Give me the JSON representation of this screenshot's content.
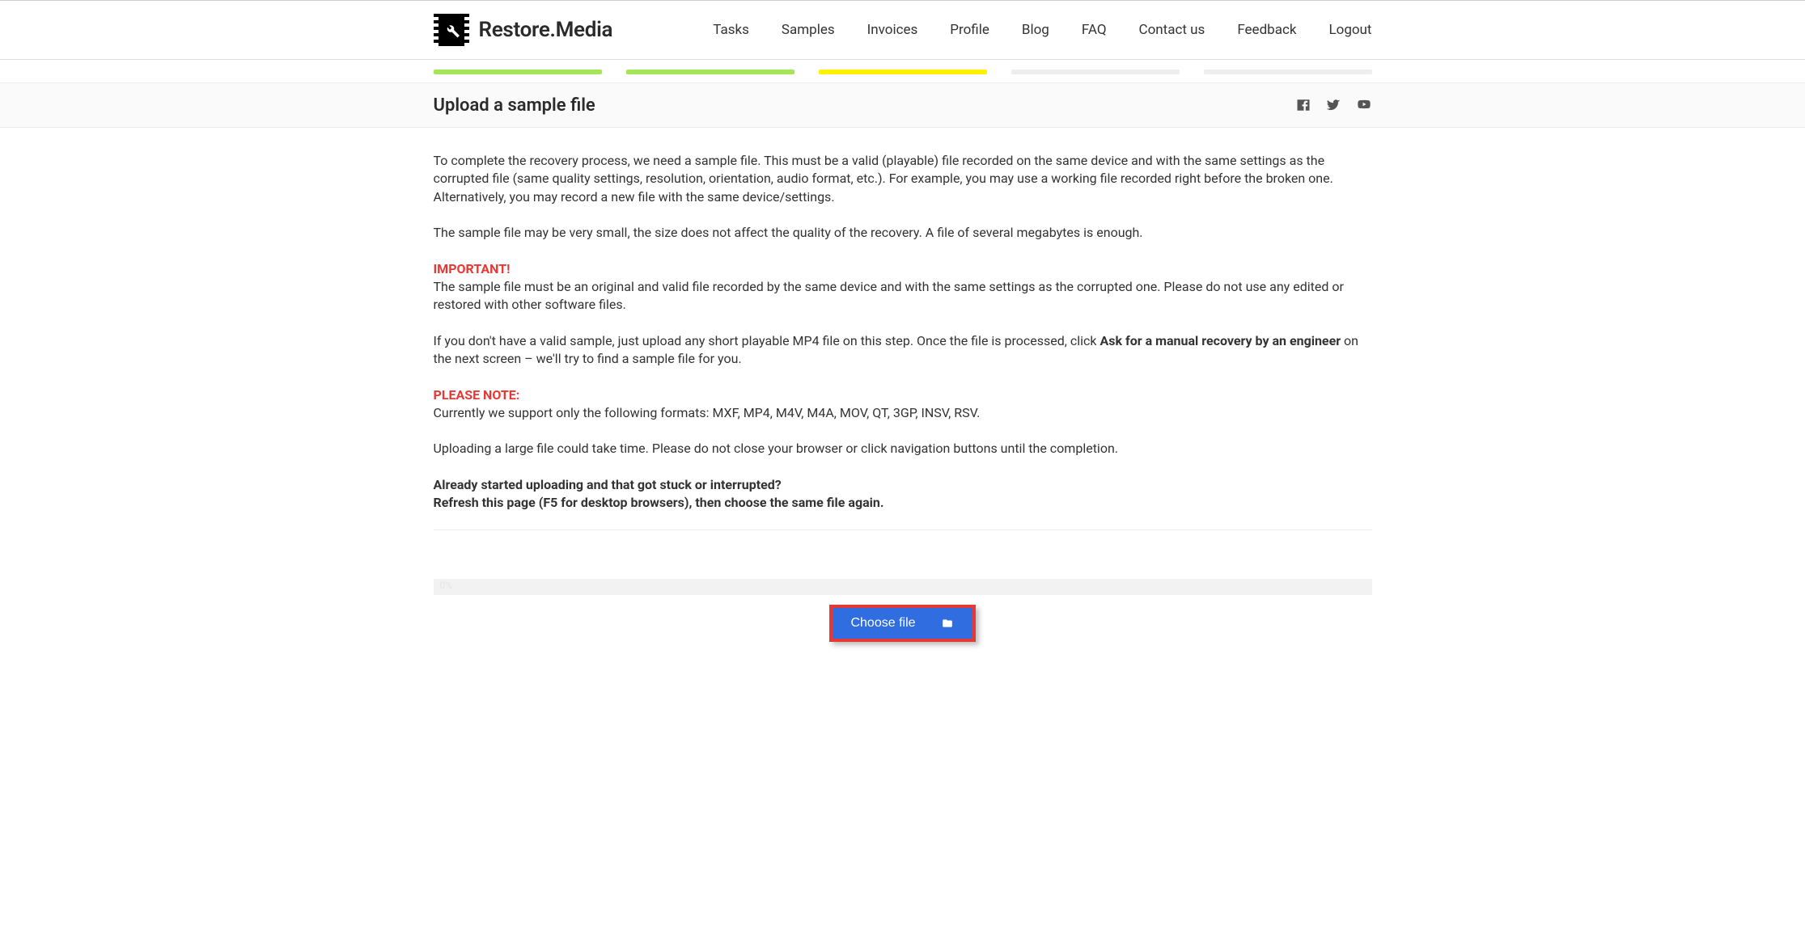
{
  "brand": "Restore.Media",
  "nav": [
    "Tasks",
    "Samples",
    "Invoices",
    "Profile",
    "Blog",
    "FAQ",
    "Contact us",
    "Feedback",
    "Logout"
  ],
  "page_title": "Upload a sample file",
  "body": {
    "p1": "To complete the recovery process, we need a sample file. This must be a valid (playable) file recorded on the same device and with the same settings as the corrupted file (same quality settings, resolution, orientation, audio format, etc.). For example, you may use a working file recorded right before the broken one. Alternatively, you may record a new file with the same device/settings.",
    "p2": "The sample file may be very small, the size does not affect the quality of the recovery. A file of several megabytes is enough.",
    "important_label": "IMPORTANT!",
    "p3": "The sample file must be an original and valid file recorded by the same device and with the same settings as the corrupted one. Please do not use any edited or restored with other software files.",
    "p4a": "If you don't have a valid sample, just upload any short playable MP4 file on this step. Once the file is processed, click ",
    "p4bold": "Ask for a manual recovery by an engineer",
    "p4b": " on the next screen – we'll try to find a sample file for you.",
    "note_label": "PLEASE NOTE:",
    "p5": "Currently we support only the following formats: MXF, MP4, M4V, M4A, MOV, QT, 3GP, INSV, RSV.",
    "p6": "Uploading a large file could take time. Please do not close your browser or click navigation buttons until the completion.",
    "p7a": "Already started uploading and that got stuck or interrupted?",
    "p7b": "Refresh this page (F5 for desktop browsers), then choose the same file again."
  },
  "upload_percent": "0%",
  "choose_label": "Choose file"
}
